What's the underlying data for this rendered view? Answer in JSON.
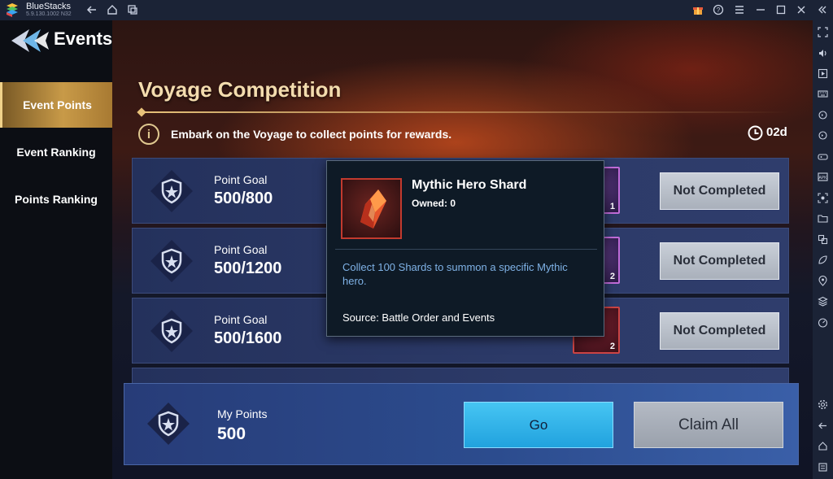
{
  "app": {
    "name": "BlueStacks",
    "version": "5.9.130.1002 N32"
  },
  "titlebar_icons": [
    "back-icon",
    "home-icon",
    "multi-instance-icon",
    "gift-icon",
    "help-icon",
    "menu-icon",
    "minimize-icon",
    "maximize-icon",
    "close-icon",
    "collapse-sidebar-icon"
  ],
  "sidebar_icons": [
    "fullscreen-icon",
    "volume-icon",
    "media-icon",
    "keyboard-icon",
    "rotate-left-icon",
    "rotate-right-icon",
    "gamepad-icon",
    "apk-icon",
    "screenshot-icon",
    "folder-icon",
    "multi-window-icon",
    "eco-mode-icon",
    "location-icon",
    "layers-icon",
    "performance-icon",
    "settings-icon",
    "back-icon",
    "home-icon",
    "recent-apps-icon"
  ],
  "header": {
    "title": "Events"
  },
  "nav": {
    "items": [
      {
        "label": "Event Points",
        "active": true
      },
      {
        "label": "Event Ranking",
        "active": false
      },
      {
        "label": "Points Ranking",
        "active": false
      }
    ]
  },
  "competition": {
    "title": "Voyage Competition",
    "info": "Embark on the Voyage to collect points for rewards.",
    "timer": "02d"
  },
  "goals": [
    {
      "label": "Point Goal",
      "value": "500/800",
      "reward_count": "1",
      "status": "Not Completed"
    },
    {
      "label": "Point Goal",
      "value": "500/1200",
      "reward_count": "2",
      "status": "Not Completed"
    },
    {
      "label": "Point Goal",
      "value": "500/1600",
      "reward_count": "2",
      "status": "Not Completed"
    }
  ],
  "tooltip": {
    "name": "Mythic Hero Shard",
    "owned": "Owned: 0",
    "description": "Collect 100 Shards to summon a specific Mythic hero.",
    "source": "Source: Battle Order and Events"
  },
  "my_points": {
    "label": "My Points",
    "value": "500"
  },
  "buttons": {
    "go": "Go",
    "claim_all": "Claim All"
  },
  "colors": {
    "title_gold": "#f3dcae",
    "tooltip_desc": "#7fb2e6",
    "go_button": "#21a2de",
    "active_nav": "#c89a48"
  }
}
